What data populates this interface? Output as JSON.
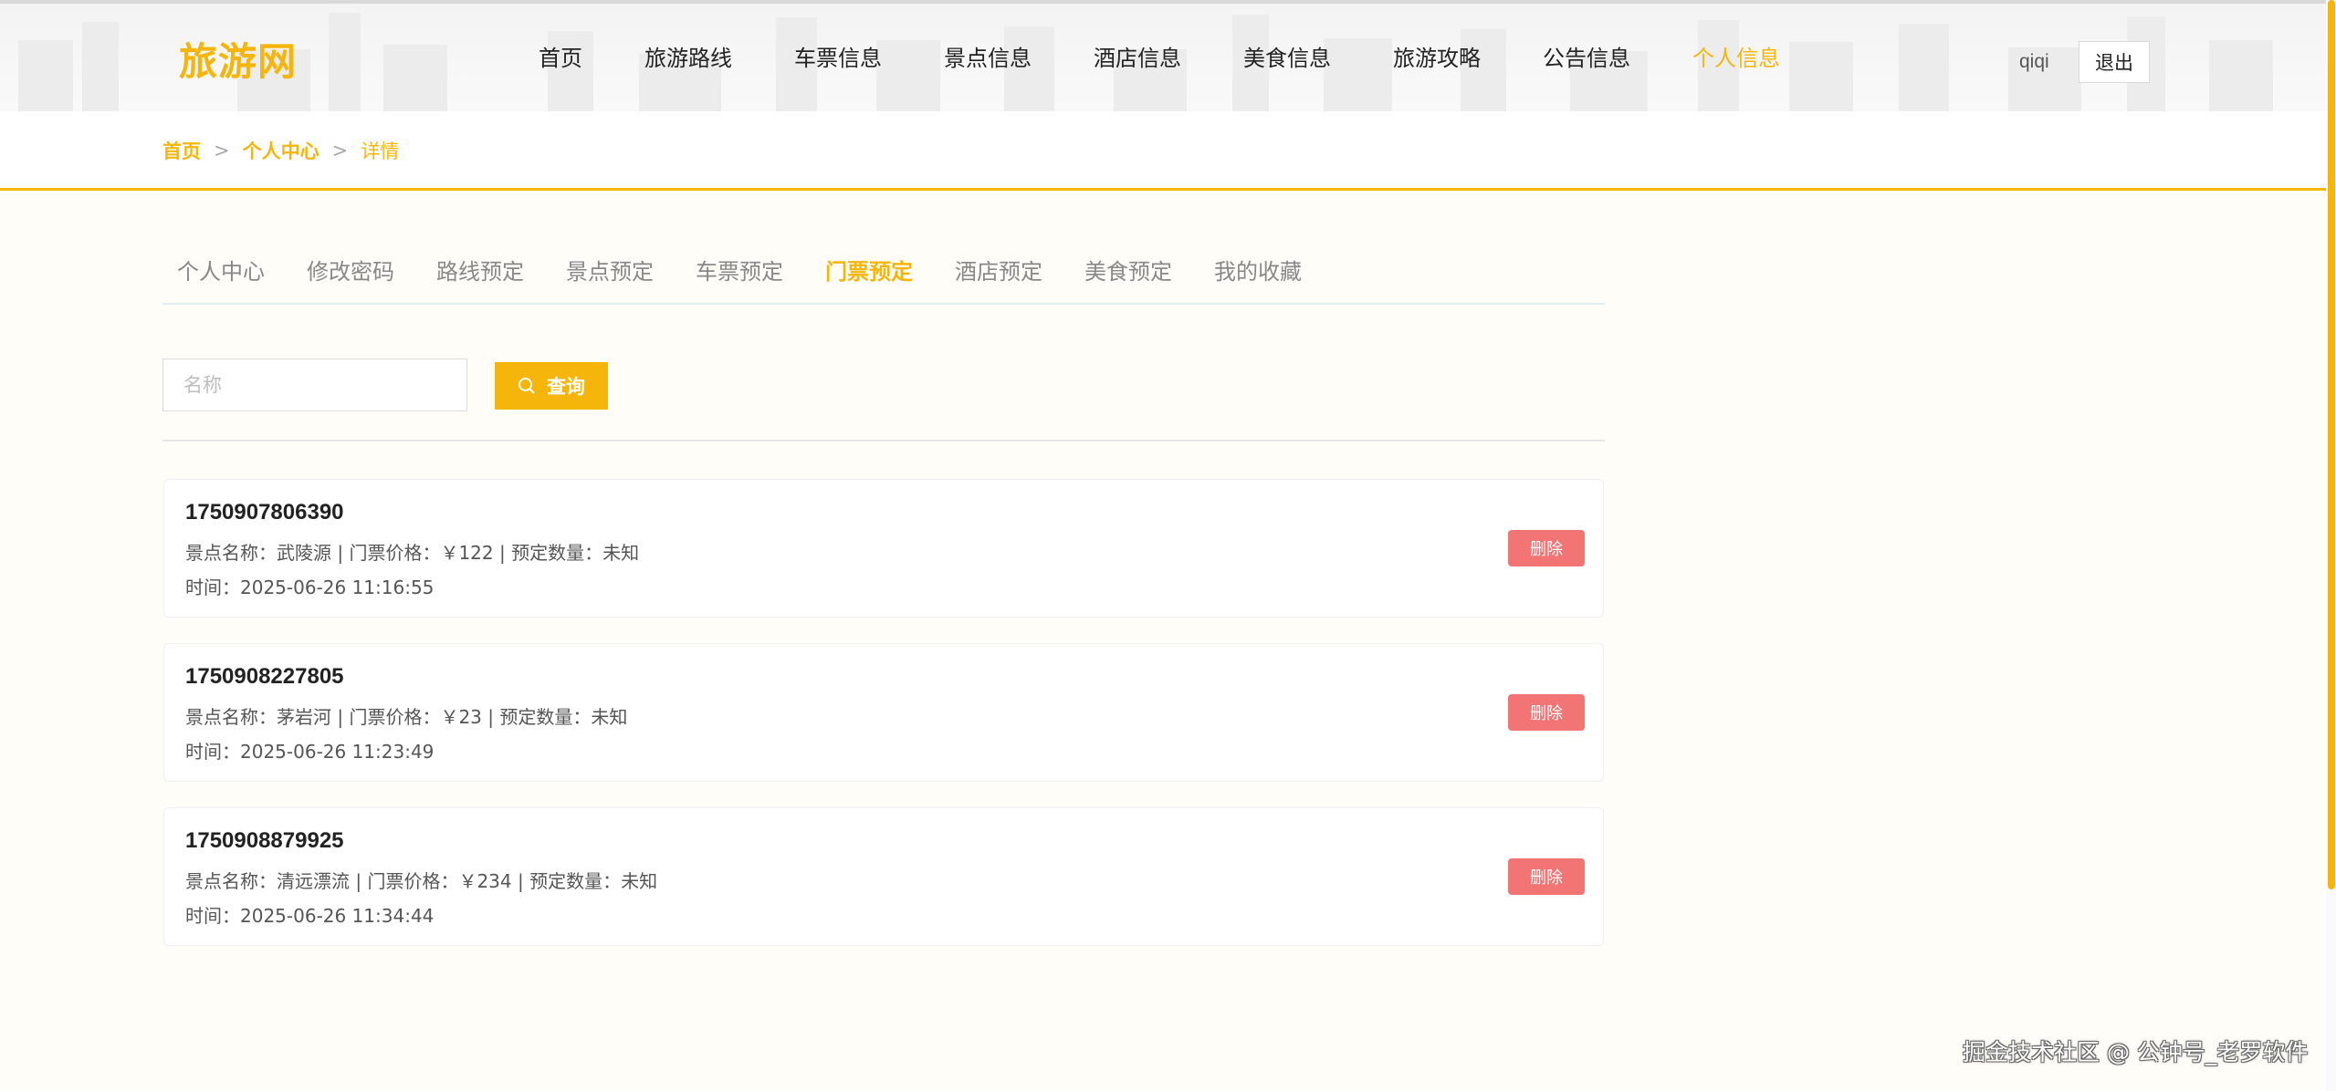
{
  "header": {
    "logo": "旅游网",
    "nav": [
      {
        "label": "首页",
        "active": false
      },
      {
        "label": "旅游路线",
        "active": false
      },
      {
        "label": "车票信息",
        "active": false
      },
      {
        "label": "景点信息",
        "active": false
      },
      {
        "label": "酒店信息",
        "active": false
      },
      {
        "label": "美食信息",
        "active": false
      },
      {
        "label": "旅游攻略",
        "active": false
      },
      {
        "label": "公告信息",
        "active": false
      },
      {
        "label": "个人信息",
        "active": true
      }
    ],
    "username": "qiqi",
    "logout_label": "退出"
  },
  "breadcrumb": {
    "items": [
      "首页",
      "个人中心",
      "详情"
    ],
    "separator": ">"
  },
  "tabs": [
    {
      "label": "个人中心",
      "active": false
    },
    {
      "label": "修改密码",
      "active": false
    },
    {
      "label": "路线预定",
      "active": false
    },
    {
      "label": "景点预定",
      "active": false
    },
    {
      "label": "车票预定",
      "active": false
    },
    {
      "label": "门票预定",
      "active": true
    },
    {
      "label": "酒店预定",
      "active": false
    },
    {
      "label": "美食预定",
      "active": false
    },
    {
      "label": "我的收藏",
      "active": false
    }
  ],
  "search": {
    "placeholder": "名称",
    "value": "",
    "button_label": "查询"
  },
  "orders": [
    {
      "order_no": "1750907806390",
      "info": "景点名称：武陵源 | 门票价格：￥122 | 预定数量：未知",
      "time": "时间：2025-06-26 11:16:55",
      "delete_label": "删除"
    },
    {
      "order_no": "1750908227805",
      "info": "景点名称：茅岩河 | 门票价格：￥23 | 预定数量：未知",
      "time": "时间：2025-06-26 11:23:49",
      "delete_label": "删除"
    },
    {
      "order_no": "1750908879925",
      "info": "景点名称：清远漂流 | 门票价格：￥234 | 预定数量：未知",
      "time": "时间：2025-06-26 11:34:44",
      "delete_label": "删除"
    }
  ],
  "watermark": "掘金技术社区 @ 公钟号_老罗软件",
  "colors": {
    "accent": "#f5b50a",
    "delete": "#f27474"
  }
}
